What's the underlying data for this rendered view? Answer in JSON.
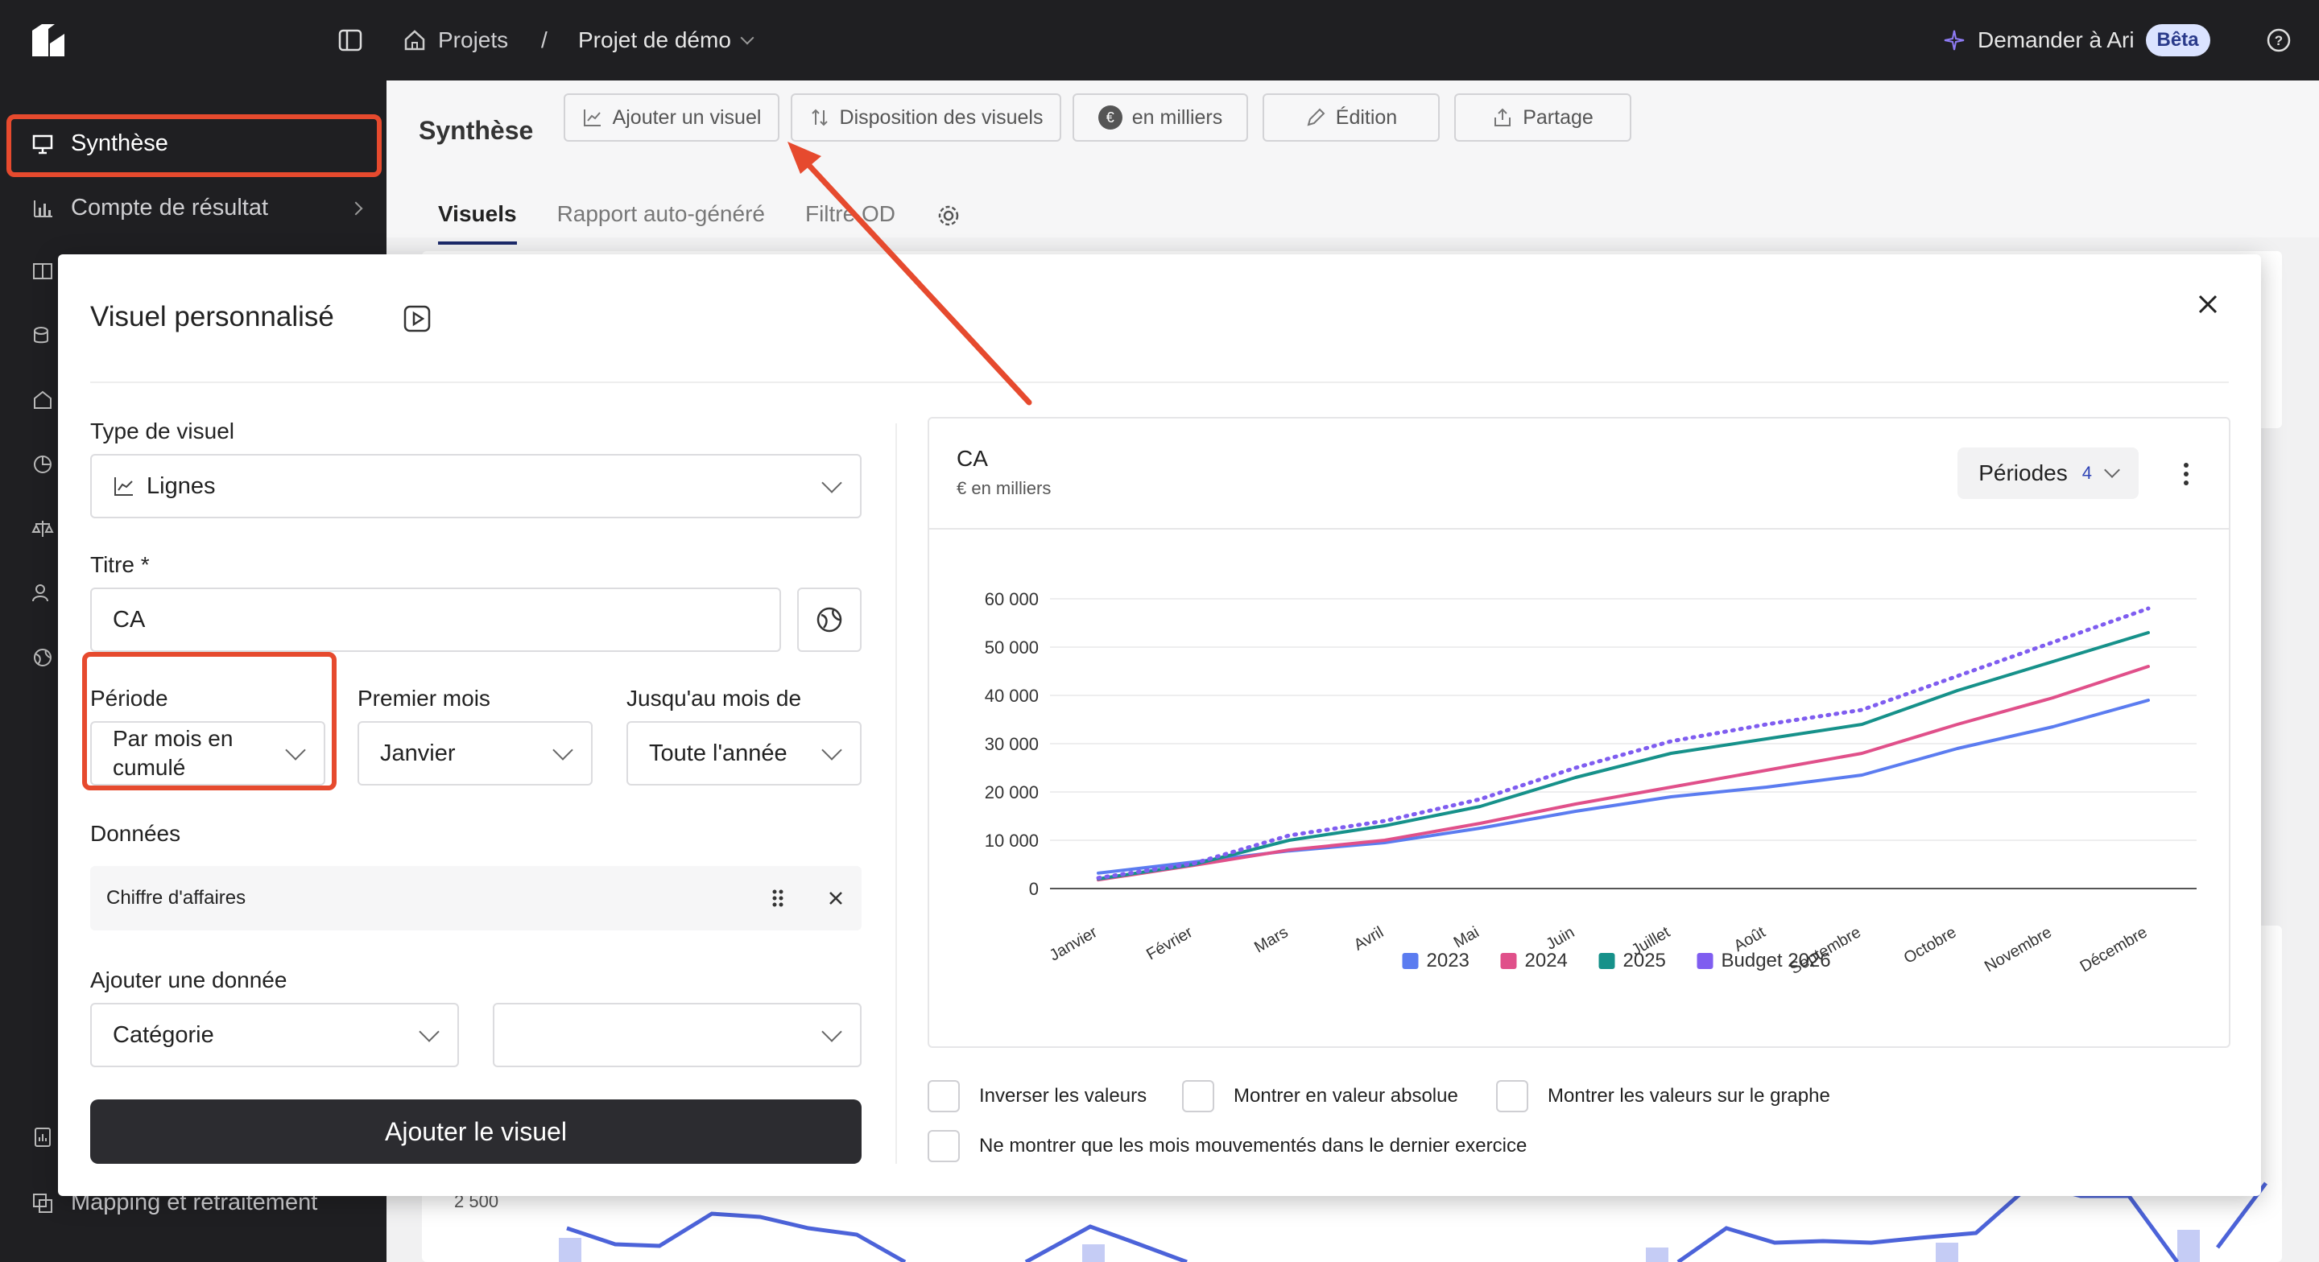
{
  "topbar": {
    "projects": "Projets",
    "separator": "/",
    "project_name": "Projet de démo",
    "ask_ari": "Demander à Ari",
    "beta": "Bêta"
  },
  "sidebar": {
    "items": [
      {
        "label": "Synthèse"
      },
      {
        "label": "Compte de résultat"
      },
      {
        "label": "Mapping et retraitement"
      }
    ]
  },
  "app": {
    "title": "Synthèse",
    "buttons": {
      "add_visual": "Ajouter un visuel",
      "layout": "Disposition des visuels",
      "thousands": "en milliers",
      "edit": "Édition",
      "share": "Partage"
    },
    "tabs": [
      "Visuels",
      "Rapport auto-généré",
      "Filtre OD"
    ],
    "bg_axis_label": "2 500"
  },
  "modal": {
    "title": "Visuel personnalisé",
    "type_label": "Type de visuel",
    "type_value": "Lignes",
    "title_label": "Titre *",
    "title_value": "CA",
    "period_label": "Période",
    "period_value": "Par mois en cumulé",
    "first_month_label": "Premier mois",
    "first_month_value": "Janvier",
    "until_label": "Jusqu'au mois de",
    "until_value": "Toute l'année",
    "data_label": "Données",
    "data_item": "Chiffre d'affaires",
    "add_data_label": "Ajouter une donnée",
    "add_data_category": "Catégorie",
    "add_data_value": "",
    "submit": "Ajouter le visuel"
  },
  "chart_panel": {
    "title": "CA",
    "subtitle": "€ en milliers",
    "periods_label": "Périodes",
    "periods_count": "4"
  },
  "checkboxes": [
    "Inverser les valeurs",
    "Montrer en valeur absolue",
    "Montrer les valeurs sur le graphe",
    "Ne montrer que les mois mouvementés dans le dernier exercice"
  ],
  "colors": {
    "accent_red": "#e64a2e",
    "s2023": "#5b7cf0",
    "s2024": "#e0508a",
    "s2025": "#16918a",
    "budget": "#7f5df0"
  },
  "chart_data": {
    "type": "line",
    "title": "CA",
    "subtitle": "€ en milliers",
    "categories": [
      "Janvier",
      "Février",
      "Mars",
      "Avril",
      "Mai",
      "Juin",
      "Juillet",
      "Août",
      "Septembre",
      "Octobre",
      "Novembre",
      "Décembre"
    ],
    "yticks": [
      "0",
      "10 000",
      "20 000",
      "30 000",
      "40 000",
      "50 000",
      "60 000"
    ],
    "ylim": [
      0,
      60000
    ],
    "legend_position": "bottom",
    "series": [
      {
        "name": "2023",
        "color": "#5b7cf0",
        "style": "solid",
        "values": [
          3200,
          5500,
          7800,
          9500,
          12500,
          16000,
          19000,
          21000,
          23500,
          29000,
          33500,
          39000
        ]
      },
      {
        "name": "2024",
        "color": "#e0508a",
        "style": "solid",
        "values": [
          1800,
          4800,
          8000,
          10000,
          13500,
          17500,
          21000,
          24500,
          28000,
          34000,
          39500,
          46000
        ]
      },
      {
        "name": "2025",
        "color": "#16918a",
        "style": "solid",
        "values": [
          2000,
          5000,
          10000,
          13000,
          17000,
          23000,
          28000,
          31000,
          34000,
          41000,
          47000,
          53000
        ]
      },
      {
        "name": "Budget 2026",
        "color": "#7f5df0",
        "style": "dotted",
        "values": [
          2200,
          5200,
          11000,
          14000,
          18500,
          25000,
          30500,
          34000,
          37000,
          44000,
          51000,
          58000
        ]
      }
    ]
  }
}
